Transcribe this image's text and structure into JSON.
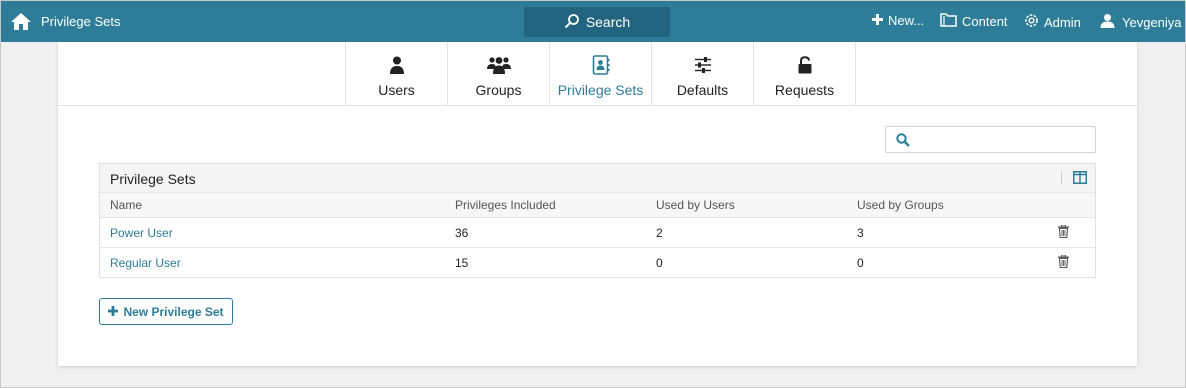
{
  "topbar": {
    "app_title": "Privilege Sets",
    "search_label": "Search",
    "new_label": "New...",
    "content_label": "Content",
    "admin_label": "Admin",
    "user_name": "Yevgeniya"
  },
  "tabs": [
    {
      "label": "Users",
      "icon": "user-icon"
    },
    {
      "label": "Groups",
      "icon": "groups-icon"
    },
    {
      "label": "Privilege Sets",
      "icon": "privilege-sets-icon",
      "active": true
    },
    {
      "label": "Defaults",
      "icon": "sliders-icon"
    },
    {
      "label": "Requests",
      "icon": "unlock-icon"
    }
  ],
  "filter": {
    "value": "",
    "placeholder": ""
  },
  "panel": {
    "title": "Privilege Sets",
    "columns": [
      "Name",
      "Privileges Included",
      "Used by Users",
      "Used by Groups"
    ],
    "rows": [
      {
        "name": "Power User",
        "privileges": "36",
        "users": "2",
        "groups": "3"
      },
      {
        "name": "Regular User",
        "privileges": "15",
        "users": "0",
        "groups": "0"
      }
    ]
  },
  "new_button_label": "New Privilege Set",
  "colors": {
    "accent": "#2e7d98",
    "topbar": "#2e7d98",
    "search_bg": "#236580"
  }
}
